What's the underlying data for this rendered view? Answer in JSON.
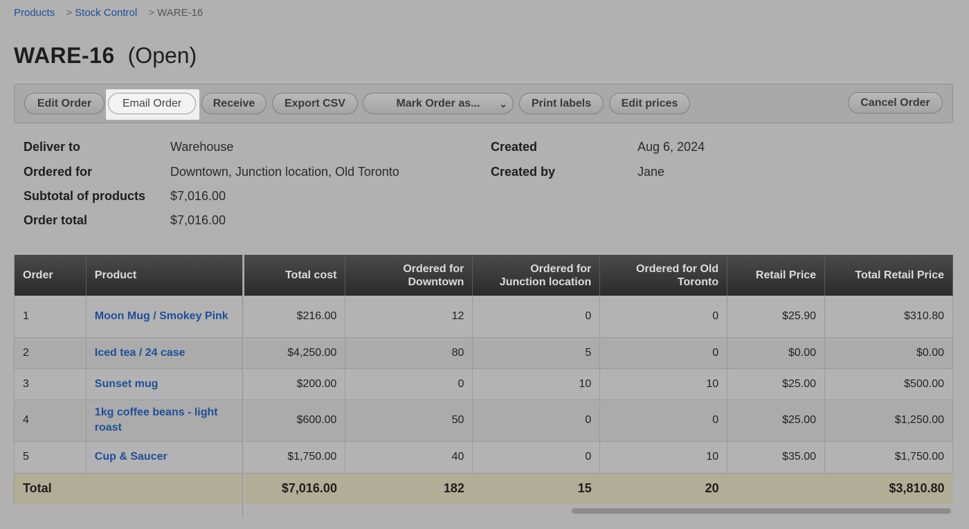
{
  "breadcrumb": {
    "items": [
      "Products",
      "Stock Control"
    ],
    "separator": ">",
    "current": "WARE-16"
  },
  "page": {
    "code": "WARE-16",
    "status": "(Open)"
  },
  "toolbar": {
    "edit_order": "Edit Order",
    "email_order": "Email Order",
    "receive": "Receive",
    "export_csv": "Export CSV",
    "mark_order_as": "Mark Order as...",
    "print_labels": "Print labels",
    "edit_prices": "Edit prices",
    "cancel_order": "Cancel Order"
  },
  "details": {
    "deliver_to_label": "Deliver to",
    "deliver_to": "Warehouse",
    "ordered_for_label": "Ordered for",
    "ordered_for": "Downtown, Junction location, Old Toronto",
    "subtotal_label": "Subtotal of products",
    "subtotal": "$7,016.00",
    "order_total_label": "Order total",
    "order_total": "$7,016.00",
    "created_label": "Created",
    "created": "Aug 6, 2024",
    "created_by_label": "Created by",
    "created_by": "Jane"
  },
  "table": {
    "headers": [
      "Order",
      "Product",
      "Total cost",
      "Ordered for Downtown",
      "Ordered for Junction location",
      "Ordered for Old Toronto",
      "Retail Price",
      "Total Retail Price"
    ],
    "rows": [
      {
        "order": "1",
        "product": "Moon Mug / Smokey Pink",
        "total_cost": "$216.00",
        "downtown": "12",
        "junction": "0",
        "old_toronto": "0",
        "retail": "$25.90",
        "total_retail": "$310.80"
      },
      {
        "order": "2",
        "product": "Iced tea / 24 case",
        "total_cost": "$4,250.00",
        "downtown": "80",
        "junction": "5",
        "old_toronto": "0",
        "retail": "$0.00",
        "total_retail": "$0.00"
      },
      {
        "order": "3",
        "product": "Sunset mug",
        "total_cost": "$200.00",
        "downtown": "0",
        "junction": "10",
        "old_toronto": "10",
        "retail": "$25.00",
        "total_retail": "$500.00"
      },
      {
        "order": "4",
        "product": "1kg coffee beans - light roast",
        "total_cost": "$600.00",
        "downtown": "50",
        "junction": "0",
        "old_toronto": "0",
        "retail": "$25.00",
        "total_retail": "$1,250.00"
      },
      {
        "order": "5",
        "product": "Cup & Saucer",
        "total_cost": "$1,750.00",
        "downtown": "40",
        "junction": "0",
        "old_toronto": "10",
        "retail": "$35.00",
        "total_retail": "$1,750.00"
      }
    ],
    "total": {
      "label": "Total",
      "total_cost": "$7,016.00",
      "downtown": "182",
      "junction": "15",
      "old_toronto": "20",
      "retail": "",
      "total_retail": "$3,810.80"
    }
  },
  "colors": {
    "link": "#1f4f9a",
    "header_bg": "#333333",
    "total_row": "#b2ad96"
  }
}
